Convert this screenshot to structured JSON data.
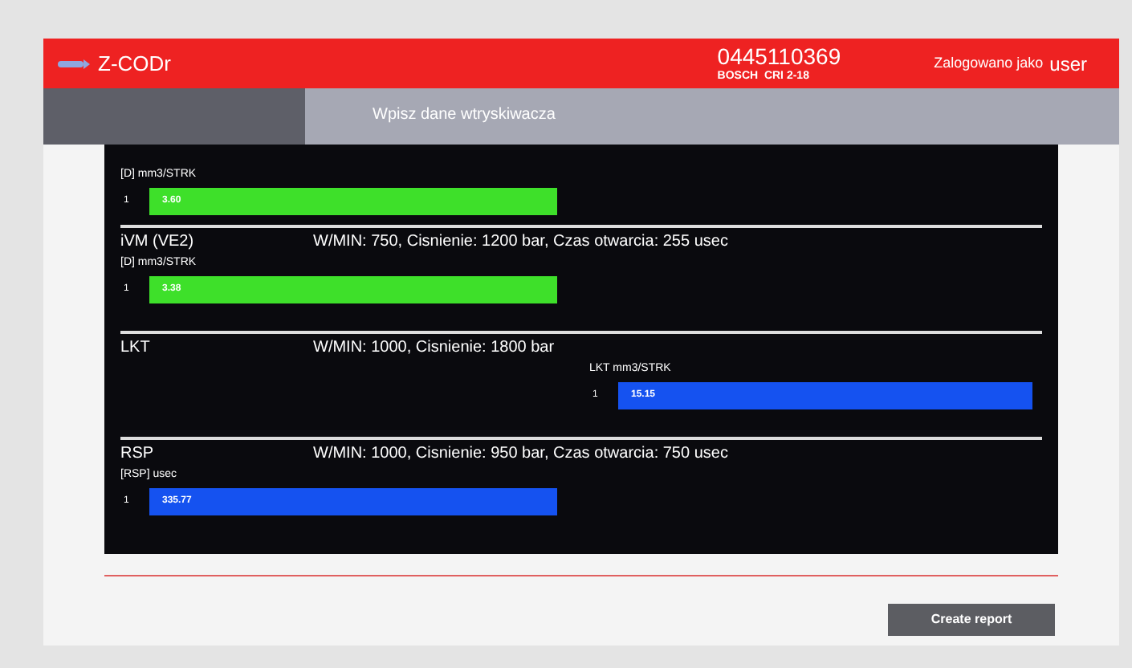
{
  "header": {
    "app_name": "Z-CODr",
    "injector_number": "0445110369",
    "injector_type": "BOSCH  CRI 2-18",
    "login_label": "Zalogowano jako",
    "user": "user"
  },
  "subheader": {
    "title": "Wpisz dane wtryskiwacza"
  },
  "sections": [
    {
      "unit": "[D] mm3/STRK",
      "row": "1",
      "value": "3.60",
      "color": "#3ee02a",
      "kind": "left"
    },
    {
      "title": "iVM (VE2)",
      "description": "W/MIN: 750, Cisnienie: 1200 bar, Czas otwarcia: 255 usec",
      "unit": "[D] mm3/STRK",
      "row": "1",
      "value": "3.38",
      "color": "#3ee02a",
      "kind": "left"
    },
    {
      "title": "LKT",
      "description": "W/MIN: 1000, Cisnienie: 1800 bar",
      "unit": "LKT mm3/STRK",
      "row": "1",
      "value": "15.15",
      "color": "#1552f0",
      "kind": "right"
    },
    {
      "title": "RSP",
      "description": "W/MIN: 1000, Cisnienie: 950 bar, Czas otwarcia: 750 usec",
      "unit": "[RSP] usec",
      "row": "1",
      "value": "335.77",
      "color": "#1552f0",
      "kind": "left"
    }
  ],
  "create_report_button": "Create report"
}
